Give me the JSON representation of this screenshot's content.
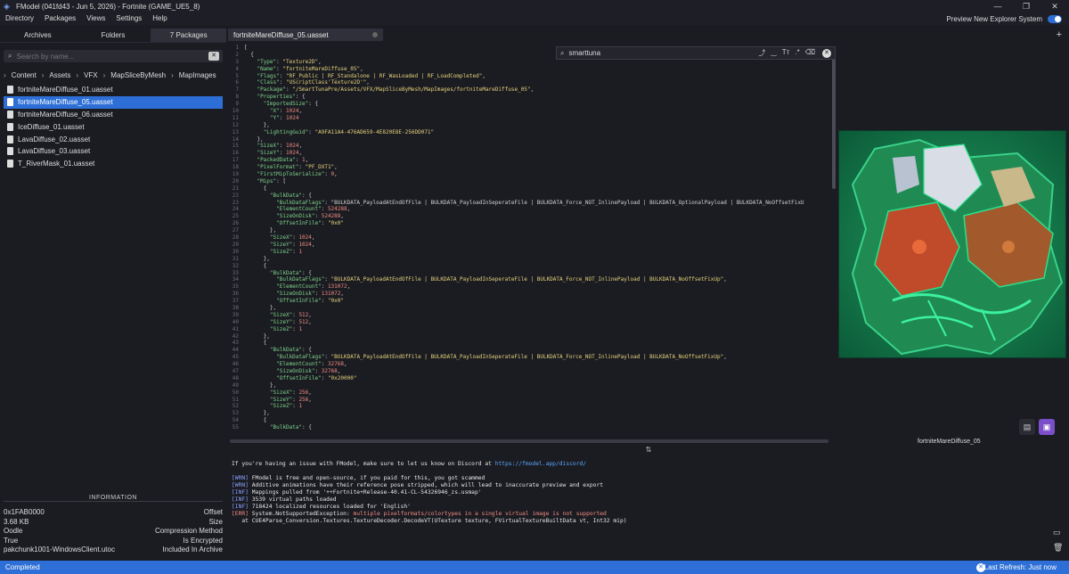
{
  "window": {
    "title": "FModel (041fd43 - Jun 5, 2026) - Fortnite (GAME_UE5_8)",
    "btn_min": "—",
    "btn_max": "❐",
    "btn_close": "✕"
  },
  "menu": [
    "Directory",
    "Packages",
    "Views",
    "Settings",
    "Help"
  ],
  "preview_toggle_label": "Preview New Explorer System",
  "left_tabs": [
    "Archives",
    "Folders",
    "7 Packages"
  ],
  "search": {
    "placeholder": "Search by name..."
  },
  "breadcrumb": [
    "Content",
    "Assets",
    "VFX",
    "MapSliceByMesh",
    "MapImages"
  ],
  "files": [
    "fortniteMareDiffuse_01.uasset",
    "fortniteMareDiffuse_05.uasset",
    "fortniteMareDiffuse_06.uasset",
    "IceDiffuse_01.uasset",
    "LavaDiffuse_02.uasset",
    "LavaDiffuse_03.uasset",
    "T_RiverMask_01.uasset"
  ],
  "information": {
    "title": "INFORMATION",
    "rows": [
      [
        "0x1FAB0000",
        "Offset"
      ],
      [
        "3.68 KB",
        "Size"
      ],
      [
        "Oodle",
        "Compression Method"
      ],
      [
        "True",
        "Is Encrypted"
      ],
      [
        "pakchunk1001-WindowsClient.utoc",
        "Included In Archive"
      ]
    ]
  },
  "editor_tab": "fortniteMareDiffuse_05.uasset",
  "find": {
    "value": "smarttuna",
    "opts": [
      "⤴",
      "‿",
      "Tт",
      ".*",
      "⌫"
    ]
  },
  "code_lines": [
    "[",
    "  {",
    "    \"Type\": \"Texture2D\",",
    "    \"Name\": \"fortniteMareDiffuse_05\",",
    "    \"Flags\": \"RF_Public | RF_Standalone | RF_WasLoaded | RF_LoadCompleted\",",
    "    \"Class\": \"UScriptClass'Texture2D'\",",
    "    \"Package\": \"/SmartTunaPre/Assets/VFX/MapSliceByMesh/MapImages/fortniteMareDiffuse_05\",",
    "    \"Properties\": {",
    "      \"ImportedSize\": {",
    "        \"X\": 1024,",
    "        \"Y\": 1024",
    "      },",
    "      \"LightingGuid\": \"A9FA11A4-476AD659-4E820E8E-256DD071\"",
    "    },",
    "    \"SizeX\": 1024,",
    "    \"SizeY\": 1024,",
    "    \"PackedData\": 1,",
    "    \"PixelFormat\": \"PF_DXT1\",",
    "    \"FirstMipToSerialize\": 0,",
    "    \"Mips\": [",
    "      {",
    "        \"BulkData\": {",
    "          \"BulkDataFlags\": \"BULKDATA_PayloadAtEndOfFile | BULKDATA_PayloadInSeperateFile | BULKDATA_Force_NOT_InlinePayload | BULKDATA_OptionalPayload | BULKDATA_NoOffsetFixU",
    "          \"ElementCount\": 524288,",
    "          \"SizeOnDisk\": 524288,",
    "          \"OffsetInFile\": \"0x0\"",
    "        },",
    "        \"SizeX\": 1024,",
    "        \"SizeY\": 1024,",
    "        \"SizeZ\": 1",
    "      },",
    "      {",
    "        \"BulkData\": {",
    "          \"BulkDataFlags\": \"BULKDATA_PayloadAtEndOfFile | BULKDATA_PayloadInSeperateFile | BULKDATA_Force_NOT_InlinePayload | BULKDATA_NoOffsetFixUp\",",
    "          \"ElementCount\": 131072,",
    "          \"SizeOnDisk\": 131072,",
    "          \"OffsetInFile\": \"0x0\"",
    "        },",
    "        \"SizeX\": 512,",
    "        \"SizeY\": 512,",
    "        \"SizeZ\": 1",
    "      },",
    "      {",
    "        \"BulkData\": {",
    "          \"BulkDataFlags\": \"BULKDATA_PayloadAtEndOfFile | BULKDATA_PayloadInSeperateFile | BULKDATA_Force_NOT_InlinePayload | BULKDATA_NoOffsetFixUp\",",
    "          \"ElementCount\": 32768,",
    "          \"SizeOnDisk\": 32768,",
    "          \"OffsetInFile\": \"0x20000\"",
    "        },",
    "        \"SizeX\": 256,",
    "        \"SizeY\": 256,",
    "        \"SizeZ\": 1",
    "      },",
    "      {",
    "        \"BulkData\": {"
  ],
  "preview": {
    "label": "fortniteMareDiffuse_05"
  },
  "log": [
    {
      "kind": "info",
      "text": "If you're having an issue with FModel, make sure to let us know on Discord at ",
      "link": "https://fmodel.app/discord/"
    },
    {
      "kind": "blank",
      "text": ""
    },
    {
      "kind": "wrn",
      "tag": "[WRN]",
      "text": " FModel is free and open-source, if you paid for this, you got scammed"
    },
    {
      "kind": "wrn",
      "tag": "[WRN]",
      "text": " Additive animations have their reference pose stripped, which will lead to inaccurate preview and export"
    },
    {
      "kind": "inf",
      "tag": "[INF]",
      "text": " Mappings pulled from '++Fortnite+Release-40.41-CL-54326946_zs.usmap'"
    },
    {
      "kind": "inf",
      "tag": "[INF]",
      "text": " 3539 virtual paths loaded"
    },
    {
      "kind": "inf",
      "tag": "[INF]",
      "text": " 718424 localized resources loaded for 'English'"
    },
    {
      "kind": "err",
      "tag": "[ERR]",
      "text": " System.NotSupportedException: ",
      "err": "multiple pixelformats/colortypes in a single virtual image is not supported"
    },
    {
      "kind": "info",
      "text": "   at CUE4Parse_Conversion.Textures.TextureDecoder.DecodeVT(UTexture texture, FVirtualTextureBuiltData vt, Int32 mip)"
    }
  ],
  "status": {
    "left": "Completed",
    "right": "Last Refresh: Just now"
  },
  "colors": {
    "accent": "#2d6fd6",
    "preview_btn": "#7b4fc9"
  }
}
